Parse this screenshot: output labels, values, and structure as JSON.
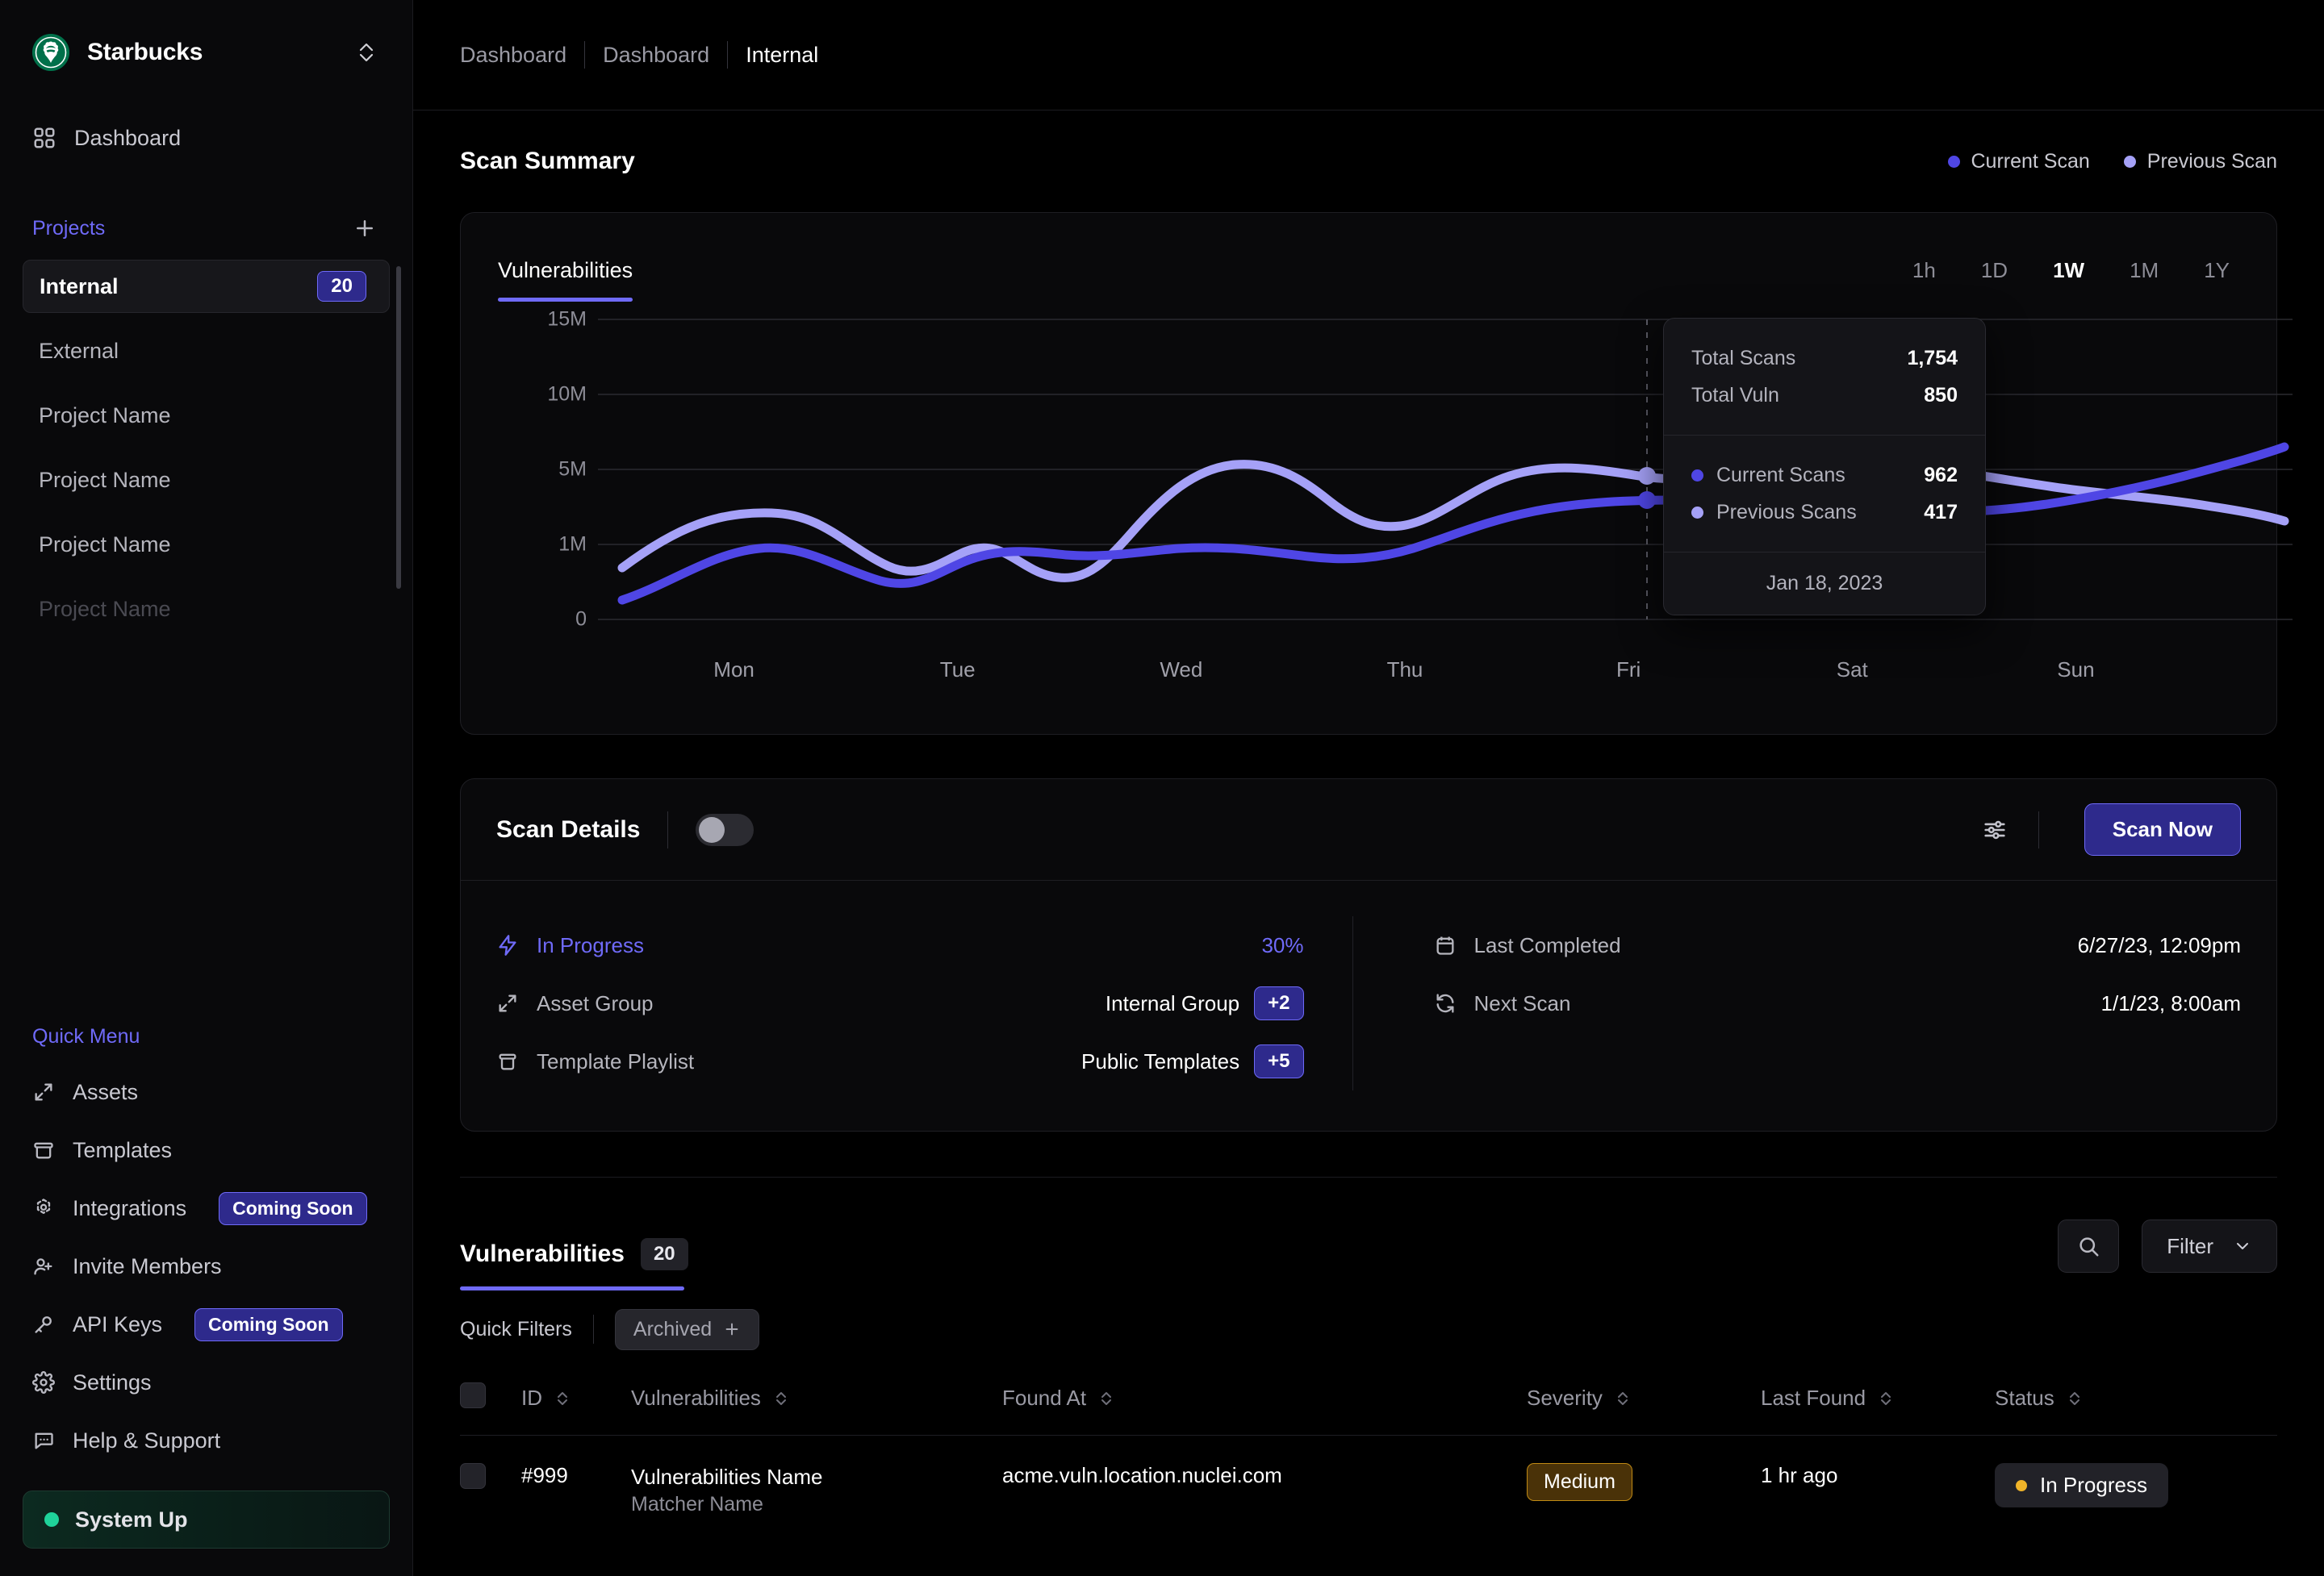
{
  "sidebar": {
    "org": {
      "name": "Starbucks",
      "switch_icon": "chevron-up-down-icon"
    },
    "nav": [
      {
        "label": "Dashboard",
        "icon": "grid-icon"
      }
    ],
    "projects_section": {
      "label": "Projects",
      "add_icon": "plus-icon"
    },
    "projects": [
      {
        "label": "Internal",
        "count": "20",
        "active": true
      },
      {
        "label": "External",
        "count": "",
        "active": false
      },
      {
        "label": "Project Name",
        "count": "",
        "active": false
      },
      {
        "label": "Project Name",
        "count": "",
        "active": false
      },
      {
        "label": "Project Name",
        "count": "",
        "active": false
      },
      {
        "label": "Project Name",
        "count": "",
        "active": false
      }
    ],
    "quick_menu_label": "Quick Menu",
    "quick_menu": [
      {
        "label": "Assets",
        "icon": "expand-icon",
        "badge": ""
      },
      {
        "label": "Templates",
        "icon": "archive-icon",
        "badge": ""
      },
      {
        "label": "Integrations",
        "icon": "integrations-icon",
        "badge": "Coming Soon"
      },
      {
        "label": "Invite Members",
        "icon": "user-plus-icon",
        "badge": ""
      },
      {
        "label": "API Keys",
        "icon": "key-icon",
        "badge": "Coming Soon"
      },
      {
        "label": "Settings",
        "icon": "gear-icon",
        "badge": ""
      },
      {
        "label": "Help & Support",
        "icon": "chat-icon",
        "badge": ""
      }
    ],
    "status": {
      "label": "System Up",
      "color": "#1fd39a"
    }
  },
  "breadcrumb": [
    {
      "label": "Dashboard",
      "current": false
    },
    {
      "label": "Dashboard",
      "current": false
    },
    {
      "label": "Internal",
      "current": true
    }
  ],
  "scan_summary": {
    "title": "Scan Summary",
    "legend": [
      {
        "label": "Current Scan",
        "color": "#4f46e5"
      },
      {
        "label": "Previous Scan",
        "color": "#a5a1f7"
      }
    ],
    "chart_tab": "Vulnerabilities",
    "ranges": [
      {
        "label": "1h",
        "active": false
      },
      {
        "label": "1D",
        "active": false
      },
      {
        "label": "1W",
        "active": true
      },
      {
        "label": "1M",
        "active": false
      },
      {
        "label": "1Y",
        "active": false
      }
    ],
    "tooltip": {
      "total_scans_label": "Total Scans",
      "total_scans_value": "1,754",
      "total_vuln_label": "Total Vuln",
      "total_vuln_value": "850",
      "current_scans_label": "Current Scans",
      "current_scans_value": "962",
      "previous_scans_label": "Previous Scans",
      "previous_scans_value": "417",
      "date": "Jan 18, 2023"
    }
  },
  "chart_data": {
    "type": "line",
    "title": "Vulnerabilities",
    "xlabel": "",
    "ylabel": "",
    "categories": [
      "Mon",
      "Tue",
      "Wed",
      "Thu",
      "Fri",
      "Sat",
      "Sun"
    ],
    "x_tick_labels": [
      "Mon",
      "Tue",
      "Wed",
      "Thu",
      "Fri",
      "Sat",
      "Sun"
    ],
    "y_tick_labels": [
      "15M",
      "10M",
      "5M",
      "1M",
      "0"
    ],
    "y_tick_values": [
      15000000,
      10000000,
      5000000,
      1000000,
      0
    ],
    "ylim": [
      0,
      15000000
    ],
    "grid": true,
    "legend_position": "top-right",
    "series": [
      {
        "name": "Current Scan",
        "color": "#4f46e5",
        "values": [
          900000,
          2100000,
          1600000,
          2600000,
          2300000,
          3900000,
          4400000,
          4300000,
          5900000
        ]
      },
      {
        "name": "Previous Scan",
        "color": "#a5a1f7",
        "values": [
          1300000,
          3100000,
          1700000,
          2400000,
          1100000,
          5900000,
          4100000,
          6200000,
          5100000,
          4200000
        ]
      }
    ],
    "annotations": [
      {
        "type": "hover-marker",
        "x": "Fri",
        "series": [
          "Current Scan",
          "Previous Scan"
        ]
      }
    ]
  },
  "scan_details": {
    "title": "Scan Details",
    "toggle_on": false,
    "settings_icon": "sliders-icon",
    "scan_now_label": "Scan Now",
    "left_rows": [
      {
        "icon": "bolt-icon",
        "label": "In Progress",
        "value": "30%",
        "accent": true,
        "pill": ""
      },
      {
        "icon": "expand-icon",
        "label": "Asset Group",
        "value": "Internal Group",
        "accent": false,
        "pill": "+2"
      },
      {
        "icon": "archive-icon",
        "label": "Template Playlist",
        "value": "Public Templates",
        "accent": false,
        "pill": "+5"
      }
    ],
    "right_rows": [
      {
        "icon": "calendar-icon",
        "label": "Last Completed",
        "value": "6/27/23, 12:09pm"
      },
      {
        "icon": "refresh-icon",
        "label": "Next Scan",
        "value": "1/1/23, 8:00am"
      }
    ]
  },
  "vulnerabilities": {
    "tab_label": "Vulnerabilities",
    "count": "20",
    "search_icon": "search-icon",
    "filter_label": "Filter",
    "filter_caret": "chevron-down-icon",
    "quick_filters_label": "Quick Filters",
    "quick_filter_chips": [
      {
        "label": "Archived",
        "icon": "plus-icon"
      }
    ],
    "columns": [
      "ID",
      "Vulnerabilities",
      "Found At",
      "Severity",
      "Last Found",
      "Status"
    ],
    "rows": [
      {
        "id": "#999",
        "name": "Vulnerabilities Name",
        "matcher": "Matcher Name",
        "found_at": "acme.vuln.location.nuclei.com",
        "severity": "Medium",
        "severity_color": "#c08a14",
        "last_found": "1 hr ago",
        "status": "In Progress",
        "status_color": "#f0b429"
      }
    ]
  },
  "colors": {
    "accent": "#6f6af8",
    "accent_fill": "#2e2a8c",
    "background": "#000000",
    "panel": "#09090b",
    "border": "#1e1e23"
  }
}
